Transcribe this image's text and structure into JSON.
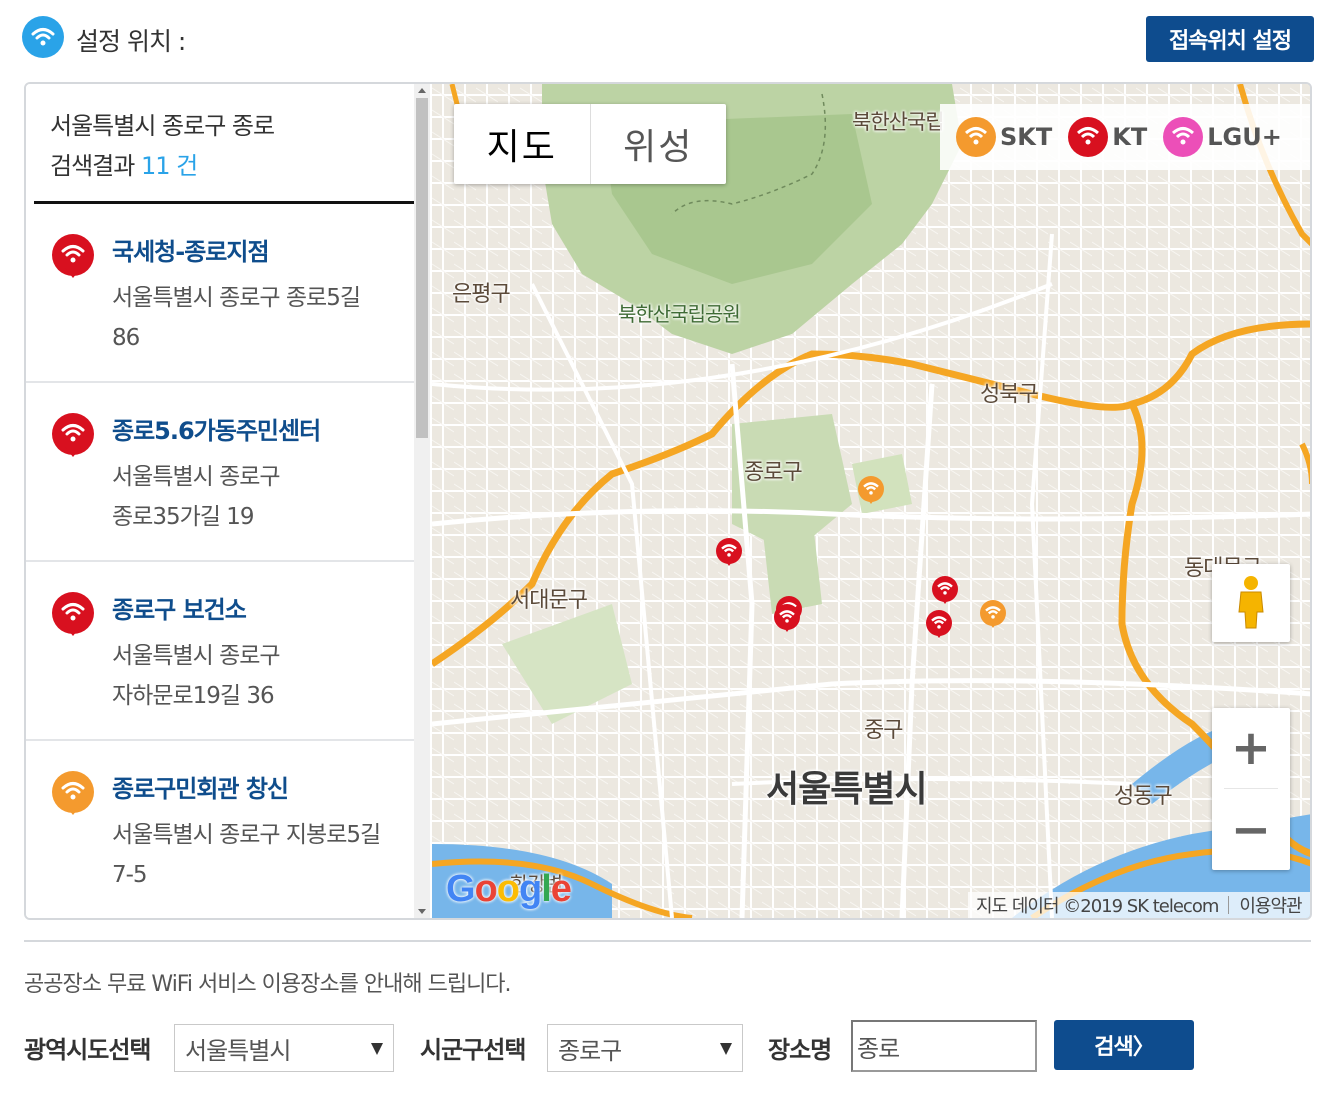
{
  "header": {
    "title": "설정 위치 :",
    "set_location_button": "접속위치 설정"
  },
  "results": {
    "query_text": "서울특별시 종로구 종로",
    "count_prefix": "검색결과 ",
    "count": "11",
    "count_suffix": " 건",
    "items": [
      {
        "name": "국세청-종로지점",
        "addr1": "서울특별시 종로구 종로5길",
        "addr2": "86",
        "carrier": "KT"
      },
      {
        "name": "종로5.6가동주민센터",
        "addr1": "서울특별시 종로구",
        "addr2": "종로35가길 19",
        "carrier": "KT"
      },
      {
        "name": "종로구 보건소",
        "addr1": "서울특별시 종로구",
        "addr2": "자하문로19길 36",
        "carrier": "KT"
      },
      {
        "name": "종로구민회관 창신",
        "addr1": "서울특별시 종로구 지봉로5길",
        "addr2": "7-5",
        "carrier": "SKT"
      }
    ]
  },
  "map": {
    "type_tabs": [
      "지도",
      "위성"
    ],
    "legend": [
      {
        "label": "SKT",
        "color": "#f49a2e"
      },
      {
        "label": "KT",
        "color": "#d8101f"
      },
      {
        "label": "LGU+",
        "color": "#ec4fb8"
      }
    ],
    "labels": {
      "bukhansan_top": "북한산국립",
      "eunpyeong": "은평구",
      "bukhansan": "북한산국립공원",
      "seongbuk": "성북구",
      "jongno": "종로구",
      "seodaemun": "서대문구",
      "dongdaemun": "동대문구",
      "junggu": "중구",
      "seoul": "서울특별시",
      "seongdong": "성동구",
      "river": "한강변"
    },
    "zoom_in": "+",
    "zoom_out": "−",
    "google_logo": "Google",
    "attribution": "지도 데이터 ©2019 SK telecom",
    "terms": "이용약관"
  },
  "colors": {
    "primary_button": "#0e4c8e",
    "accent": "#2aa3e8",
    "kt": "#d8101f",
    "skt": "#f49a2e",
    "lgu": "#ec4fb8"
  },
  "footer": {
    "notice": "공공장소 무료 WiFi 서비스 이용장소를 안내해 드립니다.",
    "region_label": "광역시도선택",
    "region_value": "서울특별시",
    "district_label": "시군구선택",
    "district_value": "종로구",
    "place_label": "장소명",
    "place_value": "종로",
    "search_button": "검색〉"
  }
}
